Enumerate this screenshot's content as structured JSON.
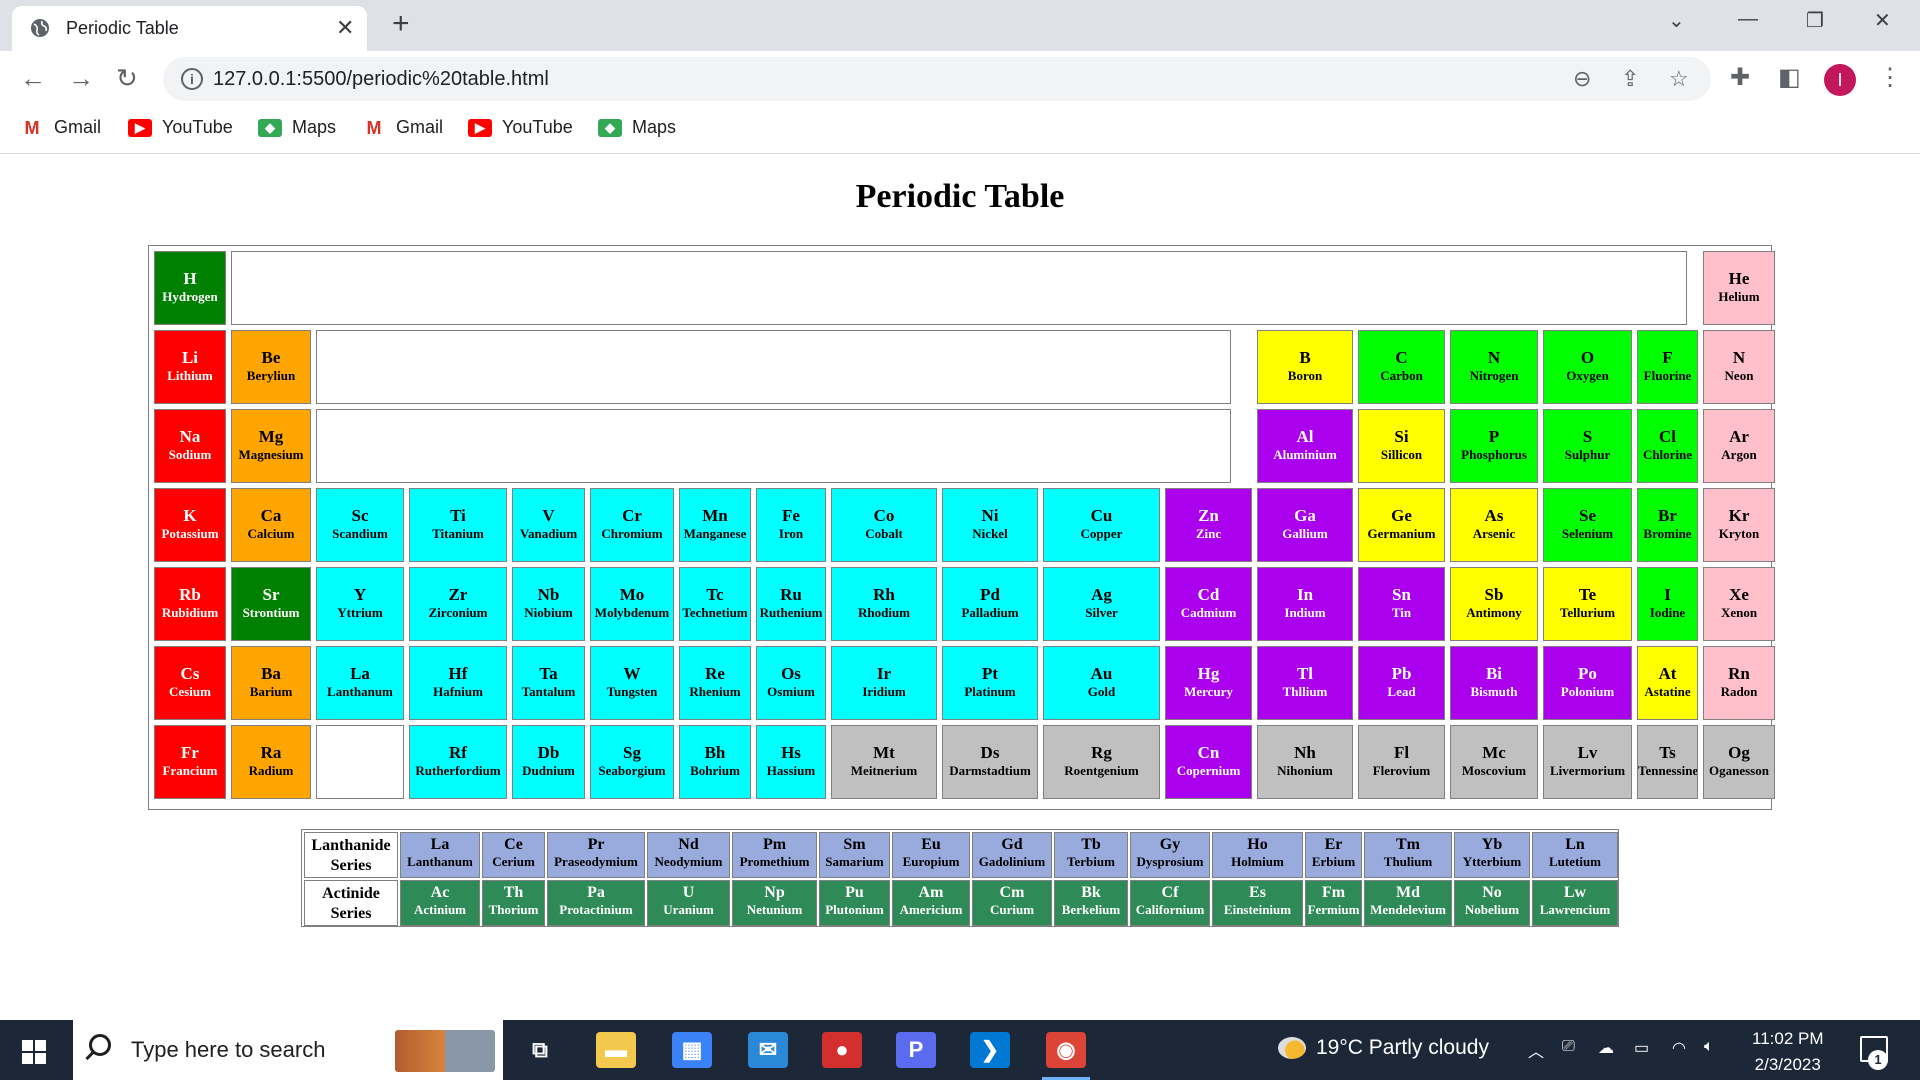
{
  "browser": {
    "tab_title": "Periodic Table",
    "tab_close": "✕",
    "new_tab": "+",
    "url": "127.0.0.1:5500/periodic%20table.html",
    "bookmarks": [
      {
        "label": "Gmail",
        "icon": "gmail-icon"
      },
      {
        "label": "YouTube",
        "icon": "youtube-icon"
      },
      {
        "label": "Maps",
        "icon": "maps-icon"
      },
      {
        "label": "Gmail",
        "icon": "gmail-icon"
      },
      {
        "label": "YouTube",
        "icon": "youtube-icon"
      },
      {
        "label": "Maps",
        "icon": "maps-icon"
      }
    ],
    "profile_initial": "I"
  },
  "page": {
    "title": "Periodic Table"
  },
  "colors": {
    "alkali": "#ff0000",
    "alkaline": "#ffa500",
    "transition": "#00ffff",
    "post_transition": "#aa00ee",
    "metalloid": "#ffff00",
    "nonmetal": "#00ff00",
    "noble": "#ffc0cb",
    "hydrogen": "#008000",
    "unknown": "#c0c0c0",
    "lanthanide": "#99aadd",
    "actinide": "#2e8b57"
  },
  "elements": [
    {
      "s": "H",
      "n": "Hydrogen",
      "c": "hydrogen",
      "r": 0,
      "g": 0
    },
    {
      "s": "He",
      "n": "Helium",
      "c": "noble",
      "r": 0,
      "g": 17
    },
    {
      "s": "Li",
      "n": "Lithium",
      "c": "alkali",
      "r": 1,
      "g": 0
    },
    {
      "s": "Be",
      "n": "Beryliun",
      "c": "alkaline",
      "r": 1,
      "g": 1
    },
    {
      "s": "B",
      "n": "Boron",
      "c": "metalloid",
      "r": 1,
      "g": 12
    },
    {
      "s": "C",
      "n": "Carbon",
      "c": "nonmetal",
      "r": 1,
      "g": 13
    },
    {
      "s": "N",
      "n": "Nitrogen",
      "c": "nonmetal",
      "r": 1,
      "g": 14
    },
    {
      "s": "O",
      "n": "Oxygen",
      "c": "nonmetal",
      "r": 1,
      "g": 15
    },
    {
      "s": "F",
      "n": "Fluorine",
      "c": "nonmetal",
      "r": 1,
      "g": 16
    },
    {
      "s": "N",
      "n": "Neon",
      "c": "noble",
      "r": 1,
      "g": 17
    },
    {
      "s": "Na",
      "n": "Sodium",
      "c": "alkali",
      "r": 2,
      "g": 0
    },
    {
      "s": "Mg",
      "n": "Magnesium",
      "c": "alkaline",
      "r": 2,
      "g": 1
    },
    {
      "s": "Al",
      "n": "Aluminium",
      "c": "post_transition",
      "r": 2,
      "g": 12
    },
    {
      "s": "Si",
      "n": "Sillicon",
      "c": "metalloid",
      "r": 2,
      "g": 13
    },
    {
      "s": "P",
      "n": "Phosphorus",
      "c": "nonmetal",
      "r": 2,
      "g": 14
    },
    {
      "s": "S",
      "n": "Sulphur",
      "c": "nonmetal",
      "r": 2,
      "g": 15
    },
    {
      "s": "Cl",
      "n": "Chlorine",
      "c": "nonmetal",
      "r": 2,
      "g": 16
    },
    {
      "s": "Ar",
      "n": "Argon",
      "c": "noble",
      "r": 2,
      "g": 17
    },
    {
      "s": "K",
      "n": "Potassium",
      "c": "alkali",
      "r": 3,
      "g": 0
    },
    {
      "s": "Ca",
      "n": "Calcium",
      "c": "alkaline",
      "r": 3,
      "g": 1
    },
    {
      "s": "Sc",
      "n": "Scandium",
      "c": "transition",
      "r": 3,
      "g": 2
    },
    {
      "s": "Ti",
      "n": "Titanium",
      "c": "transition",
      "r": 3,
      "g": 3
    },
    {
      "s": "V",
      "n": "Vanadium",
      "c": "transition",
      "r": 3,
      "g": 4
    },
    {
      "s": "Cr",
      "n": "Chromium",
      "c": "transition",
      "r": 3,
      "g": 5
    },
    {
      "s": "Mn",
      "n": "Manganese",
      "c": "transition",
      "r": 3,
      "g": 6
    },
    {
      "s": "Fe",
      "n": "Iron",
      "c": "transition",
      "r": 3,
      "g": 7
    },
    {
      "s": "Co",
      "n": "Cobalt",
      "c": "transition",
      "r": 3,
      "g": 8
    },
    {
      "s": "Ni",
      "n": "Nickel",
      "c": "transition",
      "r": 3,
      "g": 9
    },
    {
      "s": "Cu",
      "n": "Copper",
      "c": "transition",
      "r": 3,
      "g": 10
    },
    {
      "s": "Zn",
      "n": "Zinc",
      "c": "post_transition",
      "r": 3,
      "g": 11
    },
    {
      "s": "Ga",
      "n": "Gallium",
      "c": "post_transition",
      "r": 3,
      "g": 12
    },
    {
      "s": "Ge",
      "n": "Germanium",
      "c": "metalloid",
      "r": 3,
      "g": 13
    },
    {
      "s": "As",
      "n": "Arsenic",
      "c": "metalloid",
      "r": 3,
      "g": 14
    },
    {
      "s": "Se",
      "n": "Selenium",
      "c": "nonmetal",
      "r": 3,
      "g": 15
    },
    {
      "s": "Br",
      "n": "Bromine",
      "c": "nonmetal",
      "r": 3,
      "g": 16
    },
    {
      "s": "Kr",
      "n": "Kryton",
      "c": "noble",
      "r": 3,
      "g": 17
    },
    {
      "s": "Rb",
      "n": "Rubidium",
      "c": "alkali",
      "r": 4,
      "g": 0
    },
    {
      "s": "Sr",
      "n": "Strontium",
      "c": "hydrogen",
      "r": 4,
      "g": 1
    },
    {
      "s": "Y",
      "n": "Yttrium",
      "c": "transition",
      "r": 4,
      "g": 2
    },
    {
      "s": "Zr",
      "n": "Zirconium",
      "c": "transition",
      "r": 4,
      "g": 3
    },
    {
      "s": "Nb",
      "n": "Niobium",
      "c": "transition",
      "r": 4,
      "g": 4
    },
    {
      "s": "Mo",
      "n": "Molybdenum",
      "c": "transition",
      "r": 4,
      "g": 5
    },
    {
      "s": "Tc",
      "n": "Technetium",
      "c": "transition",
      "r": 4,
      "g": 6
    },
    {
      "s": "Ru",
      "n": "Ruthenium",
      "c": "transition",
      "r": 4,
      "g": 7
    },
    {
      "s": "Rh",
      "n": "Rhodium",
      "c": "transition",
      "r": 4,
      "g": 8
    },
    {
      "s": "Pd",
      "n": "Palladium",
      "c": "transition",
      "r": 4,
      "g": 9
    },
    {
      "s": "Ag",
      "n": "Silver",
      "c": "transition",
      "r": 4,
      "g": 10
    },
    {
      "s": "Cd",
      "n": "Cadmium",
      "c": "post_transition",
      "r": 4,
      "g": 11
    },
    {
      "s": "In",
      "n": "Indium",
      "c": "post_transition",
      "r": 4,
      "g": 12
    },
    {
      "s": "Sn",
      "n": "Tin",
      "c": "post_transition",
      "r": 4,
      "g": 13
    },
    {
      "s": "Sb",
      "n": "Antimony",
      "c": "metalloid",
      "r": 4,
      "g": 14
    },
    {
      "s": "Te",
      "n": "Tellurium",
      "c": "metalloid",
      "r": 4,
      "g": 15
    },
    {
      "s": "I",
      "n": "Iodine",
      "c": "nonmetal",
      "r": 4,
      "g": 16
    },
    {
      "s": "Xe",
      "n": "Xenon",
      "c": "noble",
      "r": 4,
      "g": 17
    },
    {
      "s": "Cs",
      "n": "Cesium",
      "c": "alkali",
      "r": 5,
      "g": 0
    },
    {
      "s": "Ba",
      "n": "Barium",
      "c": "alkaline",
      "r": 5,
      "g": 1
    },
    {
      "s": "La",
      "n": "Lanthanum",
      "c": "transition",
      "r": 5,
      "g": 2
    },
    {
      "s": "Hf",
      "n": "Hafnium",
      "c": "transition",
      "r": 5,
      "g": 3
    },
    {
      "s": "Ta",
      "n": "Tantalum",
      "c": "transition",
      "r": 5,
      "g": 4
    },
    {
      "s": "W",
      "n": "Tungsten",
      "c": "transition",
      "r": 5,
      "g": 5
    },
    {
      "s": "Re",
      "n": "Rhenium",
      "c": "transition",
      "r": 5,
      "g": 6
    },
    {
      "s": "Os",
      "n": "Osmium",
      "c": "transition",
      "r": 5,
      "g": 7
    },
    {
      "s": "Ir",
      "n": "Iridium",
      "c": "transition",
      "r": 5,
      "g": 8
    },
    {
      "s": "Pt",
      "n": "Platinum",
      "c": "transition",
      "r": 5,
      "g": 9
    },
    {
      "s": "Au",
      "n": "Gold",
      "c": "transition",
      "r": 5,
      "g": 10
    },
    {
      "s": "Hg",
      "n": "Mercury",
      "c": "post_transition",
      "r": 5,
      "g": 11
    },
    {
      "s": "Tl",
      "n": "Thllium",
      "c": "post_transition",
      "r": 5,
      "g": 12
    },
    {
      "s": "Pb",
      "n": "Lead",
      "c": "post_transition",
      "r": 5,
      "g": 13
    },
    {
      "s": "Bi",
      "n": "Bismuth",
      "c": "post_transition",
      "r": 5,
      "g": 14
    },
    {
      "s": "Po",
      "n": "Polonium",
      "c": "post_transition",
      "r": 5,
      "g": 15
    },
    {
      "s": "At",
      "n": "Astatine",
      "c": "metalloid",
      "r": 5,
      "g": 16
    },
    {
      "s": "Rn",
      "n": "Radon",
      "c": "noble",
      "r": 5,
      "g": 17
    },
    {
      "s": "Fr",
      "n": "Francium",
      "c": "alkali",
      "r": 6,
      "g": 0
    },
    {
      "s": "Ra",
      "n": "Radium",
      "c": "alkaline",
      "r": 6,
      "g": 1
    },
    {
      "s": "",
      "n": "",
      "c": "blank",
      "r": 6,
      "g": 2
    },
    {
      "s": "Rf",
      "n": "Rutherfordium",
      "c": "transition",
      "r": 6,
      "g": 3
    },
    {
      "s": "Db",
      "n": "Dudnium",
      "c": "transition",
      "r": 6,
      "g": 4
    },
    {
      "s": "Sg",
      "n": "Seaborgium",
      "c": "transition",
      "r": 6,
      "g": 5
    },
    {
      "s": "Bh",
      "n": "Bohrium",
      "c": "transition",
      "r": 6,
      "g": 6
    },
    {
      "s": "Hs",
      "n": "Hassium",
      "c": "transition",
      "r": 6,
      "g": 7
    },
    {
      "s": "Mt",
      "n": "Meitnerium",
      "c": "unknown",
      "r": 6,
      "g": 8
    },
    {
      "s": "Ds",
      "n": "Darmstadtium",
      "c": "unknown",
      "r": 6,
      "g": 9
    },
    {
      "s": "Rg",
      "n": "Roentgenium",
      "c": "unknown",
      "r": 6,
      "g": 10
    },
    {
      "s": "Cn",
      "n": "Copernium",
      "c": "post_transition",
      "r": 6,
      "g": 11
    },
    {
      "s": "Nh",
      "n": "Nihonium",
      "c": "unknown",
      "r": 6,
      "g": 12
    },
    {
      "s": "Fl",
      "n": "Flerovium",
      "c": "unknown",
      "r": 6,
      "g": 13
    },
    {
      "s": "Mc",
      "n": "Moscovium",
      "c": "unknown",
      "r": 6,
      "g": 14
    },
    {
      "s": "Lv",
      "n": "Livermorium",
      "c": "unknown",
      "r": 6,
      "g": 15
    },
    {
      "s": "Ts",
      "n": "Tennessine",
      "c": "unknown",
      "r": 6,
      "g": 16
    },
    {
      "s": "Og",
      "n": "Oganesson",
      "c": "unknown",
      "r": 6,
      "g": 17
    }
  ],
  "f_block": [
    {
      "label": "Lanthanide Series",
      "color": "lanthanide",
      "items": [
        {
          "s": "La",
          "n": "Lanthanum"
        },
        {
          "s": "Ce",
          "n": "Cerium"
        },
        {
          "s": "Pr",
          "n": "Praseodymium"
        },
        {
          "s": "Nd",
          "n": "Neodymium"
        },
        {
          "s": "Pm",
          "n": "Promethium"
        },
        {
          "s": "Sm",
          "n": "Samarium"
        },
        {
          "s": "Eu",
          "n": "Europium"
        },
        {
          "s": "Gd",
          "n": "Gadolinium"
        },
        {
          "s": "Tb",
          "n": "Terbium"
        },
        {
          "s": "Gy",
          "n": "Dysprosium"
        },
        {
          "s": "Ho",
          "n": "Holmium"
        },
        {
          "s": "Er",
          "n": "Erbium"
        },
        {
          "s": "Tm",
          "n": "Thulium"
        },
        {
          "s": "Yb",
          "n": "Ytterbium"
        },
        {
          "s": "Ln",
          "n": "Lutetium"
        }
      ]
    },
    {
      "label": "Actinide Series",
      "color": "actinide",
      "items": [
        {
          "s": "Ac",
          "n": "Actinium"
        },
        {
          "s": "Th",
          "n": "Thorium"
        },
        {
          "s": "Pa",
          "n": "Protactinium"
        },
        {
          "s": "U",
          "n": "Uranium"
        },
        {
          "s": "Np",
          "n": "Netunium"
        },
        {
          "s": "Pu",
          "n": "Plutonium"
        },
        {
          "s": "Am",
          "n": "Americium"
        },
        {
          "s": "Cm",
          "n": "Curium"
        },
        {
          "s": "Bk",
          "n": "Berkelium"
        },
        {
          "s": "Cf",
          "n": "Californium"
        },
        {
          "s": "Es",
          "n": "Einsteinium"
        },
        {
          "s": "Fm",
          "n": "Fermium"
        },
        {
          "s": "Md",
          "n": "Mendelevium"
        },
        {
          "s": "No",
          "n": "Nobelium"
        },
        {
          "s": "Lw",
          "n": "Lawrencium"
        }
      ]
    }
  ],
  "taskbar": {
    "search_placeholder": "Type here to search",
    "weather": "19°C  Partly cloudy",
    "time": "11:02 PM",
    "date": "2/3/2023",
    "notification_count": "1",
    "apps": [
      {
        "name": "task-view-icon",
        "glyph": "⧉",
        "bg": "transparent"
      },
      {
        "name": "file-explorer-icon",
        "glyph": "▬",
        "bg": "#f2c94c"
      },
      {
        "name": "microsoft-store-icon",
        "glyph": "▦",
        "bg": "#3b82f6"
      },
      {
        "name": "mail-icon",
        "glyph": "✉",
        "bg": "#2b88d8"
      },
      {
        "name": "screen-recorder-icon",
        "glyph": "●",
        "bg": "#d32f2f"
      },
      {
        "name": "p-app-icon",
        "glyph": "P",
        "bg": "#5b6bf0"
      },
      {
        "name": "vscode-icon",
        "glyph": "❯",
        "bg": "#0078d4"
      },
      {
        "name": "chrome-icon",
        "glyph": "◉",
        "bg": "#db4437"
      }
    ]
  }
}
